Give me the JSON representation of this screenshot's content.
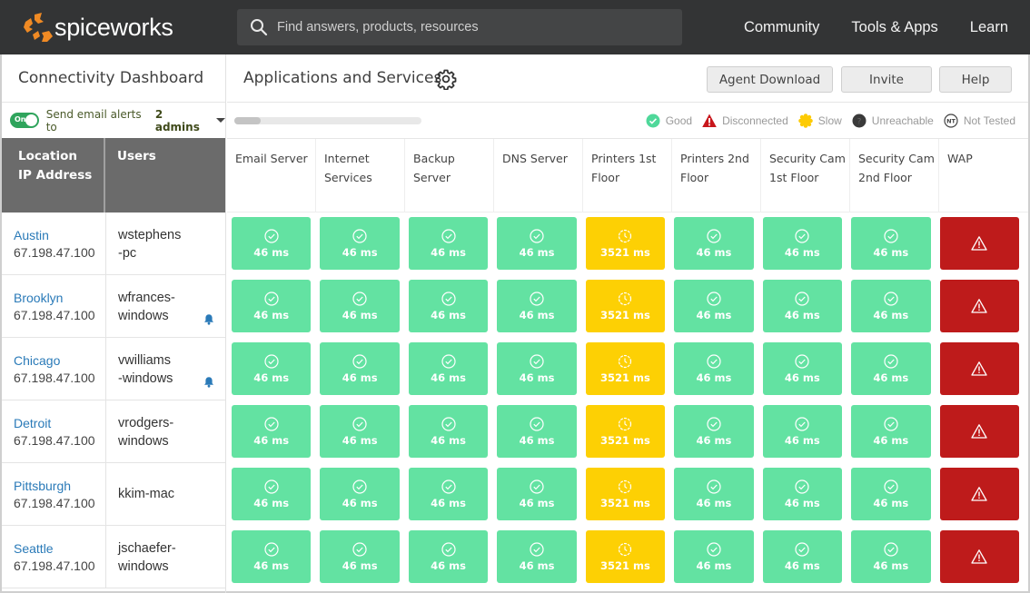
{
  "brand": {
    "name": "spiceworks",
    "logo_color": "#f08a24"
  },
  "search": {
    "placeholder": "Find answers, products, resources",
    "value": ""
  },
  "nav": [
    {
      "label": "Community"
    },
    {
      "label": "Tools & Apps"
    },
    {
      "label": "Learn"
    }
  ],
  "sidebar": {
    "title": "Connectivity Dashboard",
    "alerts": {
      "toggle_label": "On",
      "toggle_state": true,
      "text": "Send email alerts to",
      "recipients": "2 admins"
    },
    "headers": {
      "location": "Location",
      "ip": "IP Address",
      "users": "Users"
    }
  },
  "main": {
    "title": "Applications and Services",
    "buttons": {
      "agent_download": "Agent Download",
      "invite": "Invite",
      "help": "Help"
    },
    "progress": 0.14,
    "legend": [
      {
        "key": "good",
        "label": "Good",
        "color": "#4fd89a"
      },
      {
        "key": "disconnected",
        "label": "Disconnected",
        "color": "#c8161c"
      },
      {
        "key": "slow",
        "label": "Slow",
        "color": "#fdcb04"
      },
      {
        "key": "unreachable",
        "label": "Unreachable",
        "color": "#3a3a3a"
      },
      {
        "key": "not_tested",
        "label": "Not Tested",
        "badge": "NT"
      }
    ],
    "columns": [
      "Email Server",
      "Internet Services",
      "Backup Server",
      "DNS Server",
      "Printers 1st Floor",
      "Printers 2nd Floor",
      "Security Cam 1st Floor",
      "Security Cam 2nd Floor",
      "WAP"
    ]
  },
  "status_colors": {
    "good": "#63e2a2",
    "slow": "#fdd004",
    "disconnected": "#be1b1b"
  },
  "rows": [
    {
      "city": "Austin",
      "ip": "67.198.47.100",
      "user": "wstephens\n-pc",
      "alert": false,
      "cells": [
        [
          "good",
          "46 ms"
        ],
        [
          "good",
          "46 ms"
        ],
        [
          "good",
          "46 ms"
        ],
        [
          "good",
          "46 ms"
        ],
        [
          "slow",
          "3521 ms"
        ],
        [
          "good",
          "46 ms"
        ],
        [
          "good",
          "46 ms"
        ],
        [
          "good",
          "46 ms"
        ],
        [
          "disc",
          ""
        ]
      ]
    },
    {
      "city": "Brooklyn",
      "ip": "67.198.47.100",
      "user": "wfrances-\nwindows",
      "alert": true,
      "cells": [
        [
          "good",
          "46 ms"
        ],
        [
          "good",
          "46 ms"
        ],
        [
          "good",
          "46 ms"
        ],
        [
          "good",
          "46 ms"
        ],
        [
          "slow",
          "3521 ms"
        ],
        [
          "good",
          "46 ms"
        ],
        [
          "good",
          "46 ms"
        ],
        [
          "good",
          "46 ms"
        ],
        [
          "disc",
          ""
        ]
      ]
    },
    {
      "city": "Chicago",
      "ip": "67.198.47.100",
      "user": "vwilliams\n-windows",
      "alert": true,
      "cells": [
        [
          "good",
          "46 ms"
        ],
        [
          "good",
          "46 ms"
        ],
        [
          "good",
          "46 ms"
        ],
        [
          "good",
          "46 ms"
        ],
        [
          "slow",
          "3521 ms"
        ],
        [
          "good",
          "46 ms"
        ],
        [
          "good",
          "46 ms"
        ],
        [
          "good",
          "46 ms"
        ],
        [
          "disc",
          ""
        ]
      ]
    },
    {
      "city": "Detroit",
      "ip": "67.198.47.100",
      "user": "vrodgers-\nwindows",
      "alert": false,
      "cells": [
        [
          "good",
          "46 ms"
        ],
        [
          "good",
          "46 ms"
        ],
        [
          "good",
          "46 ms"
        ],
        [
          "good",
          "46 ms"
        ],
        [
          "slow",
          "3521 ms"
        ],
        [
          "good",
          "46 ms"
        ],
        [
          "good",
          "46 ms"
        ],
        [
          "good",
          "46 ms"
        ],
        [
          "disc",
          ""
        ]
      ]
    },
    {
      "city": "Pittsburgh",
      "ip": "67.198.47.100",
      "user": "kkim-mac",
      "alert": false,
      "cells": [
        [
          "good",
          "46 ms"
        ],
        [
          "good",
          "46 ms"
        ],
        [
          "good",
          "46 ms"
        ],
        [
          "good",
          "46 ms"
        ],
        [
          "slow",
          "3521 ms"
        ],
        [
          "good",
          "46 ms"
        ],
        [
          "good",
          "46 ms"
        ],
        [
          "good",
          "46 ms"
        ],
        [
          "disc",
          ""
        ]
      ]
    },
    {
      "city": "Seattle",
      "ip": "67.198.47.100",
      "user": "jschaefer-\nwindows",
      "alert": false,
      "cells": [
        [
          "good",
          "46 ms"
        ],
        [
          "good",
          "46 ms"
        ],
        [
          "good",
          "46 ms"
        ],
        [
          "good",
          "46 ms"
        ],
        [
          "slow",
          "3521 ms"
        ],
        [
          "good",
          "46 ms"
        ],
        [
          "good",
          "46 ms"
        ],
        [
          "good",
          "46 ms"
        ],
        [
          "disc",
          ""
        ]
      ]
    }
  ]
}
